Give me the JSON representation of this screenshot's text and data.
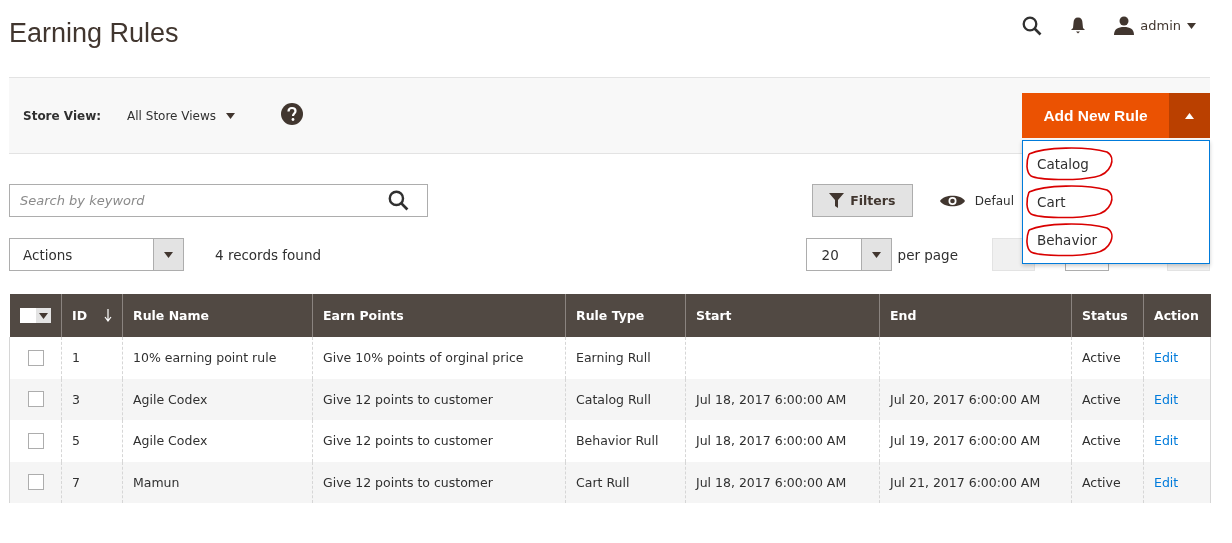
{
  "page_title": "Earning Rules",
  "header": {
    "user": "admin"
  },
  "store_view": {
    "label": "Store View:",
    "value": "All Store Views"
  },
  "add_button": {
    "label": "Add New Rule",
    "expanded": true,
    "menu": [
      {
        "label": "Catalog",
        "circled": true
      },
      {
        "label": "Cart",
        "circled": true
      },
      {
        "label": "Behavior",
        "circled": true
      }
    ]
  },
  "search": {
    "placeholder": "Search by keyword"
  },
  "filters_button": "Filters",
  "view_label": "Defaul",
  "actions_select": "Actions",
  "records": "4 records found",
  "per_page": {
    "value": "20",
    "label": "per page"
  },
  "table": {
    "columns": [
      {
        "label": "ID",
        "sorted": true
      },
      {
        "label": "Rule Name",
        "sorted": false
      },
      {
        "label": "Earn Points",
        "sorted": false
      },
      {
        "label": "Rule Type",
        "sorted": false
      },
      {
        "label": "Start",
        "sorted": false
      },
      {
        "label": "End",
        "sorted": false
      },
      {
        "label": "Status",
        "sorted": false
      },
      {
        "label": "Action",
        "sorted": false
      }
    ],
    "rows": [
      {
        "checked": false,
        "cells": [
          "1",
          "10% earning point rule",
          "Give 10% points of orginal price",
          "Earning Rull",
          "",
          "",
          "Active"
        ],
        "action": "Edit"
      },
      {
        "checked": false,
        "cells": [
          "3",
          "Agile Codex",
          "Give 12 points to customer",
          "Catalog Rull",
          "Jul 18, 2017 6:00:00 AM",
          "Jul 20, 2017 6:00:00 AM",
          "Active"
        ],
        "action": "Edit"
      },
      {
        "checked": false,
        "cells": [
          "5",
          "Agile Codex",
          "Give 12 points to customer",
          "Behavior Rull",
          "Jul 18, 2017 6:00:00 AM",
          "Jul 19, 2017 6:00:00 AM",
          "Active"
        ],
        "action": "Edit"
      },
      {
        "checked": false,
        "cells": [
          "7",
          "Mamun",
          "Give 12 points to customer",
          "Cart Rull",
          "Jul 18, 2017 6:00:00 AM",
          "Jul 21, 2017 6:00:00 AM",
          "Active"
        ],
        "action": "Edit"
      }
    ]
  }
}
